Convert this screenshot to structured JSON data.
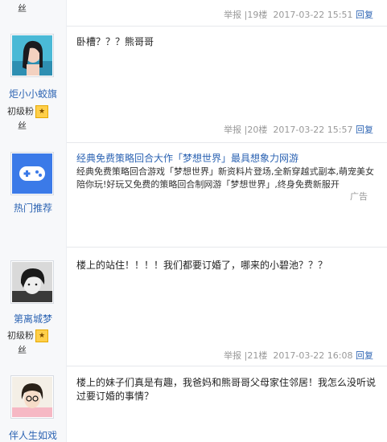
{
  "posts": [
    {
      "username": "",
      "badge_line2": "丝",
      "content": "",
      "report": "举报",
      "floor": "19楼",
      "time": "2017-03-22 15:51",
      "reply": "回复"
    },
    {
      "username": "炬小小蛟旗",
      "badge_line1": "初级粉",
      "badge_line2": "丝",
      "content": "卧槽？？？熊哥哥",
      "report": "举报",
      "floor": "20楼",
      "time": "2017-03-22 15:57",
      "reply": "回复"
    },
    {
      "username": "第离城梦",
      "badge_line1": "初级粉",
      "badge_line2": "丝",
      "content": "楼上的站住！！！！我们都要订婚了，哪来的小碧池？？？",
      "report": "举报",
      "floor": "21楼",
      "time": "2017-03-22 16:08",
      "reply": "回复"
    },
    {
      "username": "伴人生如戏",
      "content": "楼上的妹子们真是有趣，我爸妈和熊哥哥父母家住邻居！我怎么没听说过要订婚的事情？"
    }
  ],
  "ad": {
    "username": "热门推荐",
    "title": "经典免费策略回合大作「梦想世界」最具想象力网游",
    "body": "经典免费策略回合游戏「梦想世界」新资料片登场,全新穿越式副本,萌宠美女陪你玩!好玩又免费的策略回合制网游「梦想世界」,终身免费新服开",
    "label": "广告"
  },
  "level_badge_icon": "fan-level-icon",
  "colors": {
    "link": "#2d64b3",
    "meta": "#999999",
    "side_bg": "#f7f8fa",
    "ad_icon": "#3b7ae8"
  }
}
